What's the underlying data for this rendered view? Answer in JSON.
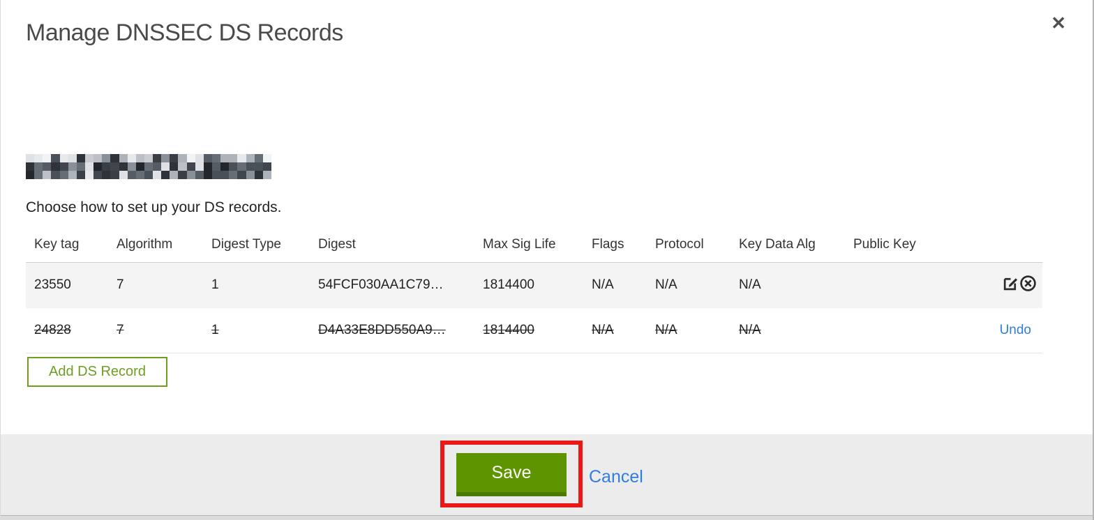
{
  "dialog": {
    "title": "Manage DNSSEC DS Records",
    "instruction": "Choose how to set up your DS records.",
    "close_glyph": "✕"
  },
  "icons": {
    "close": "close-icon",
    "edit": "edit-icon",
    "remove": "remove-circle-icon"
  },
  "table": {
    "columns": [
      "Key tag",
      "Algorithm",
      "Digest Type",
      "Digest",
      "Max Sig Life",
      "Flags",
      "Protocol",
      "Key Data Alg",
      "Public Key"
    ],
    "rows": [
      {
        "key_tag": "23550",
        "algorithm": "7",
        "digest_type": "1",
        "digest": "54FCF030AA1C79…",
        "max_sig_life": "1814400",
        "flags": "N/A",
        "protocol": "N/A",
        "key_data_alg": "N/A",
        "public_key": "",
        "state": "current"
      },
      {
        "key_tag": "24828",
        "algorithm": "7",
        "digest_type": "1",
        "digest": "D4A33E8DD550A9…",
        "max_sig_life": "1814400",
        "flags": "N/A",
        "protocol": "N/A",
        "key_data_alg": "N/A",
        "public_key": "",
        "state": "deleted",
        "action_label": "Undo"
      }
    ]
  },
  "buttons": {
    "add_ds_record": "Add DS Record",
    "save": "Save",
    "cancel": "Cancel"
  },
  "colors": {
    "button_green": "#5e9400",
    "outline_green": "#6f9e1f",
    "link_blue": "#2f7de1",
    "annotation_red": "#e81917",
    "footer_gray": "#ececec"
  }
}
